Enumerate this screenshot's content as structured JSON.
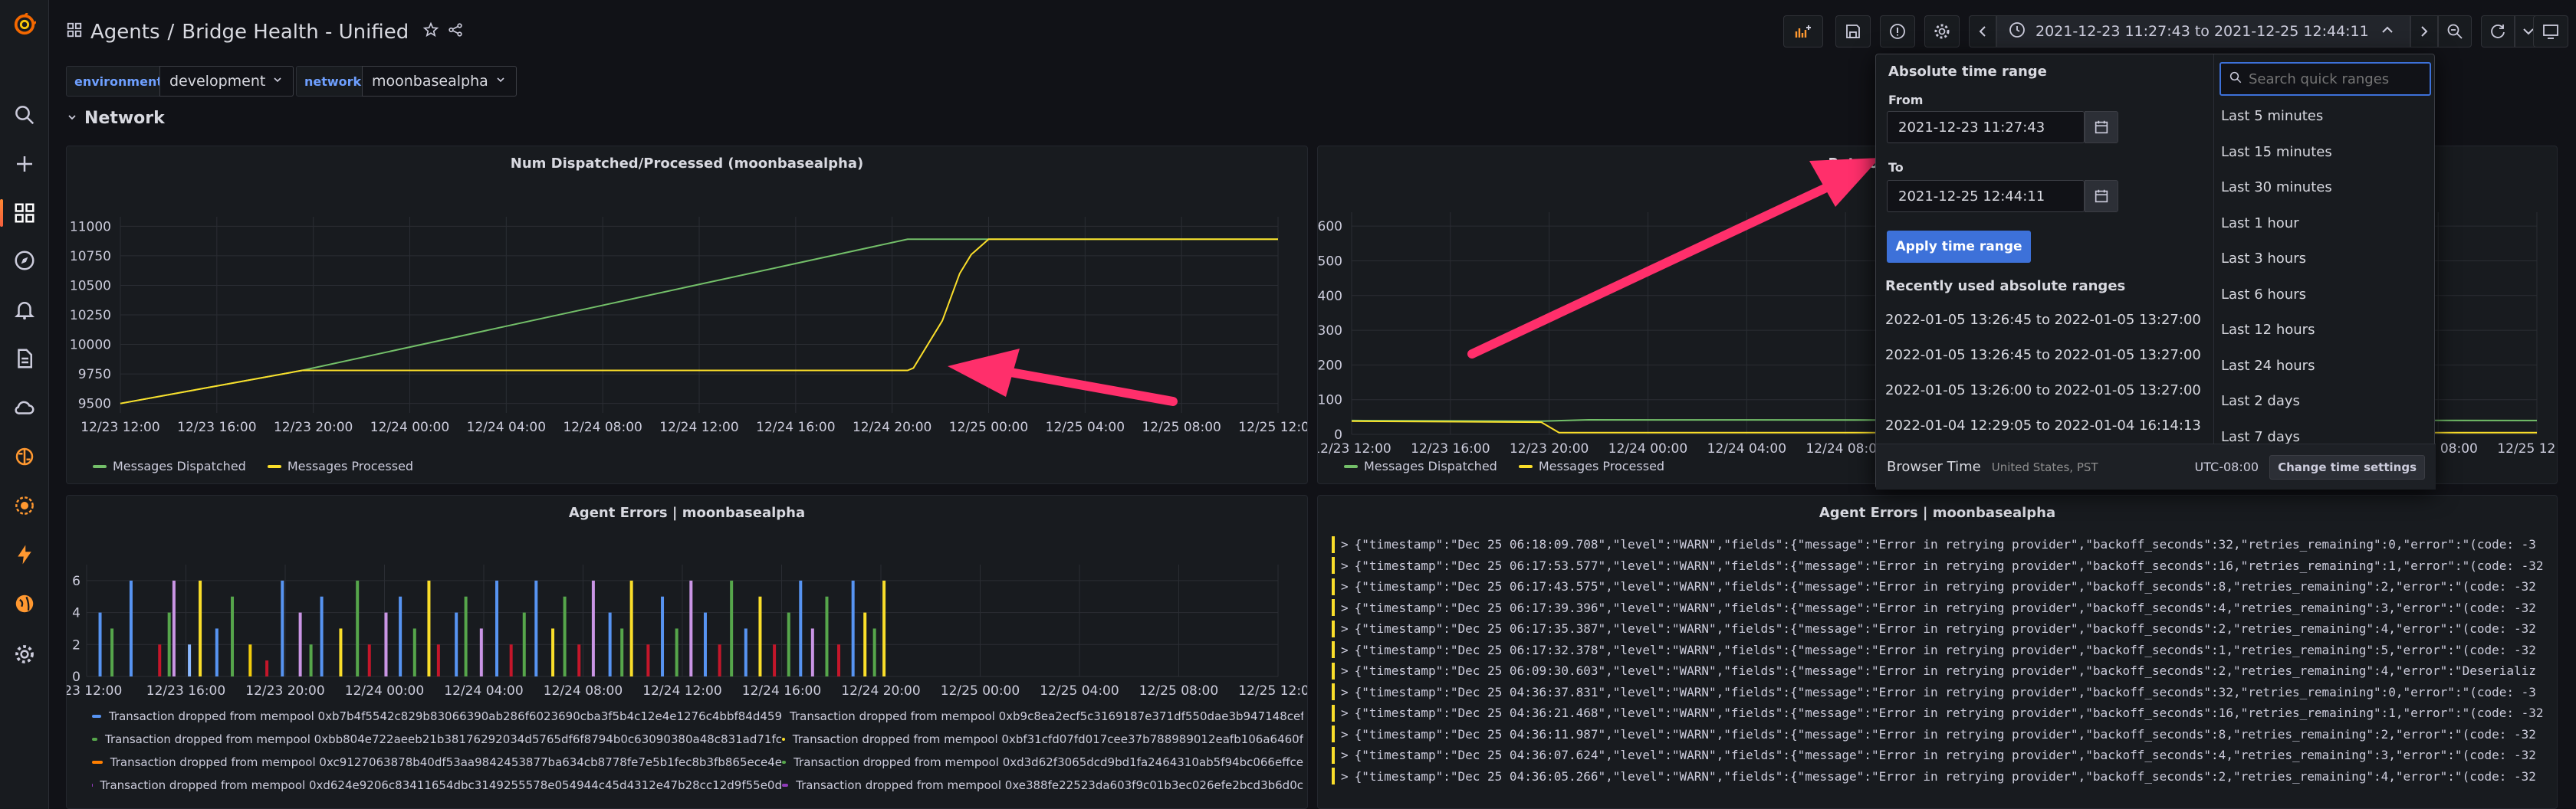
{
  "app": {
    "logo": "grafana-logo"
  },
  "sidebar": {
    "icons": [
      "search-icon",
      "plus-icon",
      "dashboards-icon",
      "explore-icon",
      "alerting-icon",
      "reports-icon",
      "cloud-icon",
      "brain-icon",
      "plugin-icon",
      "lightning-icon",
      "globe-icon",
      "gear-icon"
    ]
  },
  "header": {
    "breadcrumb_folder": "Agents",
    "breadcrumb_sep": "/",
    "dashboard_title": "Bridge Health - Unified",
    "time_range_label": "2021-12-23 11:27:43 to 2021-12-25 12:44:11"
  },
  "variables": [
    {
      "label": "environment",
      "value": "development"
    },
    {
      "label": "network",
      "value": "moonbasealpha"
    }
  ],
  "row": {
    "title": "Network"
  },
  "panels": {
    "dispatched": {
      "title": "Num Dispatched/Processed (moonbasealpha)",
      "legend": [
        "Messages Dispatched",
        "Messages Processed"
      ]
    },
    "rate": {
      "title": "Rate of D",
      "legend": [
        "Messages Dispatched",
        "Messages Processed"
      ]
    },
    "errors_chart": {
      "title": "Agent Errors | moonbasealpha"
    },
    "errors_logs": {
      "title": "Agent Errors | moonbasealpha"
    }
  },
  "chart_data": [
    {
      "type": "line",
      "title": "Num Dispatched/Processed (moonbasealpha)",
      "x_ticks": [
        "12/23 12:00",
        "12/23 16:00",
        "12/23 20:00",
        "12/24 00:00",
        "12/24 04:00",
        "12/24 08:00",
        "12/24 12:00",
        "12/24 16:00",
        "12/24 20:00",
        "12/25 00:00",
        "12/25 04:00",
        "12/25 08:00",
        "12/25 12:00"
      ],
      "y_ticks": [
        9500,
        9750,
        10000,
        10250,
        10500,
        10750,
        11000
      ],
      "ylim": [
        9420,
        11080
      ],
      "x": [
        0,
        0.157,
        0.68,
        1.0
      ],
      "series": [
        {
          "name": "Messages Dispatched",
          "color": "#73bf69",
          "points": [
            [
              0,
              9500
            ],
            [
              0.157,
              9780
            ],
            [
              0.68,
              10890
            ],
            [
              1.0,
              10890
            ]
          ]
        },
        {
          "name": "Messages Processed",
          "color": "#fade2a",
          "points": [
            [
              0,
              9500
            ],
            [
              0.157,
              9780
            ],
            [
              0.68,
              9780
            ],
            [
              0.685,
              9800
            ],
            [
              0.71,
              10200
            ],
            [
              0.725,
              10600
            ],
            [
              0.735,
              10760
            ],
            [
              0.75,
              10890
            ],
            [
              1.0,
              10890
            ]
          ]
        }
      ]
    },
    {
      "type": "line",
      "title": "Rate of D",
      "x_ticks": [
        "12/23 12:00",
        "12/23 16:00",
        "12/23 20:00",
        "12/24 00:00",
        "12/24 04:00",
        "12/24 08:00",
        "12/24 12:00",
        "12/24 16:00",
        "12/24 20:00",
        "12/25 00:00",
        "12/25 04:00",
        "12/25 08:00",
        "12/25 12:00"
      ],
      "y_ticks": [
        0,
        100,
        200,
        300,
        400,
        500,
        600
      ],
      "ylim": [
        0,
        640
      ],
      "series": [
        {
          "name": "Messages Dispatched",
          "color": "#73bf69",
          "points": [
            [
              0,
              40
            ],
            [
              0.16,
              38
            ],
            [
              0.2,
              42
            ],
            [
              1.0,
              40
            ]
          ]
        },
        {
          "name": "Messages Processed",
          "color": "#fade2a",
          "points": [
            [
              0,
              38
            ],
            [
              0.16,
              35
            ],
            [
              0.175,
              5
            ],
            [
              1.0,
              5
            ]
          ]
        }
      ]
    },
    {
      "type": "bar",
      "title": "Agent Errors | moonbasealpha",
      "x_ticks": [
        "2/23 12:00",
        "12/23 16:00",
        "12/23 20:00",
        "12/24 00:00",
        "12/24 04:00",
        "12/24 08:00",
        "12/24 12:00",
        "12/24 16:00",
        "12/24 20:00",
        "12/25 00:00",
        "12/25 04:00",
        "12/25 08:00",
        "12/25 12:00"
      ],
      "y_ticks": [
        0,
        2,
        4,
        6
      ],
      "ylim": [
        0,
        7
      ],
      "bars": [
        [
          0.01,
          4,
          "#5794f2"
        ],
        [
          0.02,
          3,
          "#56a64b"
        ],
        [
          0.036,
          6,
          "#5794f2"
        ],
        [
          0.06,
          2,
          "#c4162a"
        ],
        [
          0.068,
          4,
          "#56a64b"
        ],
        [
          0.072,
          6,
          "#ca95e5"
        ],
        [
          0.085,
          2,
          "#8ab8ff"
        ],
        [
          0.094,
          6,
          "#fade2a"
        ],
        [
          0.108,
          3,
          "#5794f2"
        ],
        [
          0.121,
          5,
          "#56a64b"
        ],
        [
          0.136,
          2,
          "#f2cc0c"
        ],
        [
          0.15,
          1,
          "#c4162a"
        ],
        [
          0.163,
          6,
          "#5794f2"
        ],
        [
          0.178,
          4,
          "#ca95e5"
        ],
        [
          0.187,
          2,
          "#56a64b"
        ],
        [
          0.196,
          5,
          "#5794f2"
        ],
        [
          0.212,
          3,
          "#fade2a"
        ],
        [
          0.226,
          6,
          "#56a64b"
        ],
        [
          0.236,
          2,
          "#c4162a"
        ],
        [
          0.25,
          4,
          "#ca95e5"
        ],
        [
          0.262,
          5,
          "#5794f2"
        ],
        [
          0.274,
          3,
          "#56a64b"
        ],
        [
          0.286,
          6,
          "#fade2a"
        ],
        [
          0.294,
          2,
          "#c4162a"
        ],
        [
          0.309,
          4,
          "#5794f2"
        ],
        [
          0.317,
          5,
          "#56a64b"
        ],
        [
          0.33,
          3,
          "#ca95e5"
        ],
        [
          0.343,
          6,
          "#5794f2"
        ],
        [
          0.355,
          2,
          "#c4162a"
        ],
        [
          0.366,
          4,
          "#56a64b"
        ],
        [
          0.376,
          6,
          "#5794f2"
        ],
        [
          0.39,
          3,
          "#fade2a"
        ],
        [
          0.4,
          5,
          "#56a64b"
        ],
        [
          0.412,
          2,
          "#c4162a"
        ],
        [
          0.424,
          6,
          "#ca95e5"
        ],
        [
          0.438,
          4,
          "#5794f2"
        ],
        [
          0.448,
          3,
          "#56a64b"
        ],
        [
          0.456,
          6,
          "#fade2a"
        ],
        [
          0.47,
          2,
          "#c4162a"
        ],
        [
          0.482,
          5,
          "#5794f2"
        ],
        [
          0.494,
          3,
          "#56a64b"
        ],
        [
          0.506,
          6,
          "#ca95e5"
        ],
        [
          0.518,
          4,
          "#5794f2"
        ],
        [
          0.53,
          2,
          "#c4162a"
        ],
        [
          0.54,
          6,
          "#56a64b"
        ],
        [
          0.552,
          3,
          "#5794f2"
        ],
        [
          0.564,
          5,
          "#fade2a"
        ],
        [
          0.576,
          2,
          "#c4162a"
        ],
        [
          0.588,
          4,
          "#56a64b"
        ],
        [
          0.598,
          6,
          "#5794f2"
        ],
        [
          0.608,
          3,
          "#ca95e5"
        ],
        [
          0.62,
          5,
          "#56a64b"
        ],
        [
          0.63,
          2,
          "#c4162a"
        ],
        [
          0.642,
          6,
          "#5794f2"
        ],
        [
          0.652,
          4,
          "#fade2a"
        ],
        [
          0.66,
          3,
          "#56a64b"
        ],
        [
          0.668,
          6,
          "#fade2a"
        ]
      ]
    }
  ],
  "errors_legend": [
    [
      "Transaction dropped from mempool 0xb7b4f5542c829b83066390ab286f6023690cba3f5b4c12e4e1276c4bbf84d459",
      "#5794f2",
      "Transaction dropped from mempool 0xb9c8ea2ecf5c3169187e371df550dae3b947148cef",
      "#ca95e5"
    ],
    [
      "Transaction dropped from mempool 0xbb804e722aeeb21b38176292034d5765df6f8794b0c63090380a48c831ad71fc",
      "#56a64b",
      "Transaction dropped from mempool 0xbf31cfd07fd017cee37b788989012eafb106a6460f",
      "#fade2a"
    ],
    [
      "Transaction dropped from mempool 0xc9127063878b40df53aa9842453877ba634cb8778fe7e5b1fec8b3fb865ece4e",
      "#ff7f00",
      "Transaction dropped from mempool 0xd3d62f3065dcd9bd1fa2464310ab5f94bc066effce",
      "#56a64b"
    ],
    [
      "Transaction dropped from mempool 0xd624e9206c83411654dbc3149255578e054944c45d4312e47b28cc12d9f55e0d",
      "#8f3bb8",
      "Transaction dropped from mempool 0xe388fe22523da603f9c01b3ec026efe2bcd3b6d0c",
      "#8f3bb8"
    ]
  ],
  "logs": [
    "{\"timestamp\":\"Dec 25 06:18:09.708\",\"level\":\"WARN\",\"fields\":{\"message\":\"Error in retrying provider\",\"backoff_seconds\":32,\"retries_remaining\":0,\"error\":\"(code: -3",
    "{\"timestamp\":\"Dec 25 06:17:53.577\",\"level\":\"WARN\",\"fields\":{\"message\":\"Error in retrying provider\",\"backoff_seconds\":16,\"retries_remaining\":1,\"error\":\"(code: -32",
    "{\"timestamp\":\"Dec 25 06:17:43.575\",\"level\":\"WARN\",\"fields\":{\"message\":\"Error in retrying provider\",\"backoff_seconds\":8,\"retries_remaining\":2,\"error\":\"(code: -32",
    "{\"timestamp\":\"Dec 25 06:17:39.396\",\"level\":\"WARN\",\"fields\":{\"message\":\"Error in retrying provider\",\"backoff_seconds\":4,\"retries_remaining\":3,\"error\":\"(code: -32",
    "{\"timestamp\":\"Dec 25 06:17:35.387\",\"level\":\"WARN\",\"fields\":{\"message\":\"Error in retrying provider\",\"backoff_seconds\":2,\"retries_remaining\":4,\"error\":\"(code: -32",
    "{\"timestamp\":\"Dec 25 06:17:32.378\",\"level\":\"WARN\",\"fields\":{\"message\":\"Error in retrying provider\",\"backoff_seconds\":1,\"retries_remaining\":5,\"error\":\"(code: -32",
    "{\"timestamp\":\"Dec 25 06:09:30.603\",\"level\":\"WARN\",\"fields\":{\"message\":\"Error in retrying provider\",\"backoff_seconds\":2,\"retries_remaining\":4,\"error\":\"Deserializ",
    "{\"timestamp\":\"Dec 25 04:36:37.831\",\"level\":\"WARN\",\"fields\":{\"message\":\"Error in retrying provider\",\"backoff_seconds\":32,\"retries_remaining\":0,\"error\":\"(code: -3",
    "{\"timestamp\":\"Dec 25 04:36:21.468\",\"level\":\"WARN\",\"fields\":{\"message\":\"Error in retrying provider\",\"backoff_seconds\":16,\"retries_remaining\":1,\"error\":\"(code: -32",
    "{\"timestamp\":\"Dec 25 04:36:11.987\",\"level\":\"WARN\",\"fields\":{\"message\":\"Error in retrying provider\",\"backoff_seconds\":8,\"retries_remaining\":2,\"error\":\"(code: -32",
    "{\"timestamp\":\"Dec 25 04:36:07.624\",\"level\":\"WARN\",\"fields\":{\"message\":\"Error in retrying provider\",\"backoff_seconds\":4,\"retries_remaining\":3,\"error\":\"(code: -32",
    "{\"timestamp\":\"Dec 25 04:36:05.266\",\"level\":\"WARN\",\"fields\":{\"message\":\"Error in retrying provider\",\"backoff_seconds\":2,\"retries_remaining\":4,\"error\":\"(code: -32"
  ],
  "picker": {
    "heading": "Absolute time range",
    "from_label": "From",
    "from_value": "2021-12-23 11:27:43",
    "to_label": "To",
    "to_value": "2021-12-25 12:44:11",
    "apply_label": "Apply time range",
    "recent_heading": "Recently used absolute ranges",
    "recent": [
      "2022-01-05 13:26:45 to 2022-01-05 13:27:00",
      "2022-01-05 13:26:45 to 2022-01-05 13:27:00",
      "2022-01-05 13:26:00 to 2022-01-05 13:27:00",
      "2022-01-04 12:29:05 to 2022-01-04 16:14:13"
    ],
    "search_placeholder": "Search quick ranges",
    "quick_ranges": [
      "Last 5 minutes",
      "Last 15 minutes",
      "Last 30 minutes",
      "Last 1 hour",
      "Last 3 hours",
      "Last 6 hours",
      "Last 12 hours",
      "Last 24 hours",
      "Last 2 days",
      "Last 7 days"
    ],
    "browser_time_label": "Browser Time",
    "browser_time_zone": "United States, PST",
    "utc_offset": "UTC-08:00",
    "change_settings_label": "Change time settings"
  },
  "colors": {
    "accent": "#3d71d9",
    "arrow": "#ff2f6b",
    "green": "#73bf69",
    "yellow": "#fade2a"
  }
}
